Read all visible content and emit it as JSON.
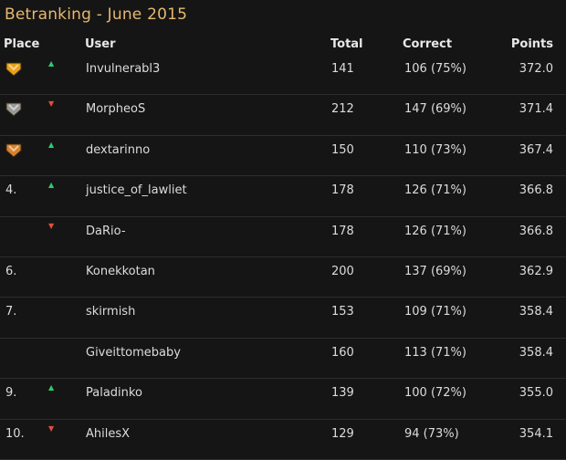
{
  "title": "Betranking - June 2015",
  "headers": {
    "place": "Place",
    "user": "User",
    "total": "Total",
    "correct": "Correct",
    "points": "Points"
  },
  "rows": [
    {
      "place": "",
      "medal": "gold",
      "trend": "up",
      "user": "Invulnerabl3",
      "total": "141",
      "correct": "106 (75%)",
      "points": "372.0"
    },
    {
      "place": "",
      "medal": "silver",
      "trend": "down",
      "user": "MorpheoS",
      "total": "212",
      "correct": "147 (69%)",
      "points": "371.4"
    },
    {
      "place": "",
      "medal": "bronze",
      "trend": "up",
      "user": "dextarinno",
      "total": "150",
      "correct": "110 (73%)",
      "points": "367.4"
    },
    {
      "place": "4.",
      "medal": "",
      "trend": "up",
      "user": "justice_of_lawliet",
      "total": "178",
      "correct": "126 (71%)",
      "points": "366.8"
    },
    {
      "place": "",
      "medal": "",
      "trend": "down",
      "user": "DaRio-",
      "total": "178",
      "correct": "126 (71%)",
      "points": "366.8"
    },
    {
      "place": "6.",
      "medal": "",
      "trend": "",
      "user": "Konekkotan",
      "total": "200",
      "correct": "137 (69%)",
      "points": "362.9"
    },
    {
      "place": "7.",
      "medal": "",
      "trend": "",
      "user": "skirmish",
      "total": "153",
      "correct": "109 (71%)",
      "points": "358.4"
    },
    {
      "place": "",
      "medal": "",
      "trend": "",
      "user": "Giveittomebaby",
      "total": "160",
      "correct": "113 (71%)",
      "points": "358.4"
    },
    {
      "place": "9.",
      "medal": "",
      "trend": "up",
      "user": "Paladinko",
      "total": "139",
      "correct": "100 (72%)",
      "points": "355.0"
    },
    {
      "place": "10.",
      "medal": "",
      "trend": "down",
      "user": "AhilesX",
      "total": "129",
      "correct": "94 (73%)",
      "points": "354.1"
    }
  ],
  "colors": {
    "title": "#e6b96e",
    "up": "#2ecc71",
    "down": "#e74c3c",
    "gold": "#e8a21a",
    "silver": "#9a9a9a",
    "bronze": "#d9822b"
  }
}
